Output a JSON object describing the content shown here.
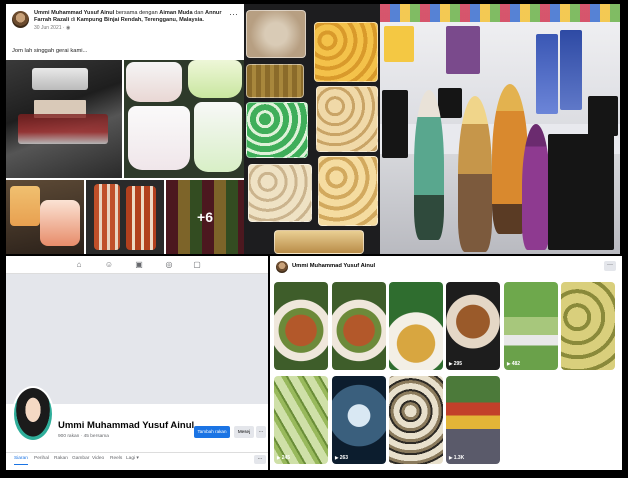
{
  "post": {
    "author": "Ummi Muhammad Yusuf Ainul",
    "with_word": "bersama dengan",
    "tagged_1": "Aiman Muda",
    "and_word": "dan",
    "tagged_2": "Annur Farrah Razali",
    "at_word": "di",
    "location": "Kampung Binjai Rendah, Terengganu, Malaysia.",
    "time": "30 Jun 2021 · ◉",
    "text": "Jom lah singgah gerai kami...",
    "more_photos": "+6"
  },
  "profile": {
    "name": "Ummi Muhammad Yusuf Ainul",
    "subtitle": "900 rakan · 45 bersama",
    "add_friend_label": "Tambah rakan",
    "message_label": "Mesej",
    "more_label": "···",
    "tabs": [
      "Siaran",
      "Perihal",
      "Rakan",
      "Gambar",
      "Video",
      "Reels",
      "Lagi ▾"
    ],
    "tabs_more_label": "···"
  },
  "reels": {
    "owner": "Ummi Muhammad Yusuf Ainul",
    "more_label": "···",
    "counts": [
      "",
      "",
      "",
      "295",
      "482",
      "",
      "245",
      "263",
      "",
      "1.3K"
    ]
  }
}
